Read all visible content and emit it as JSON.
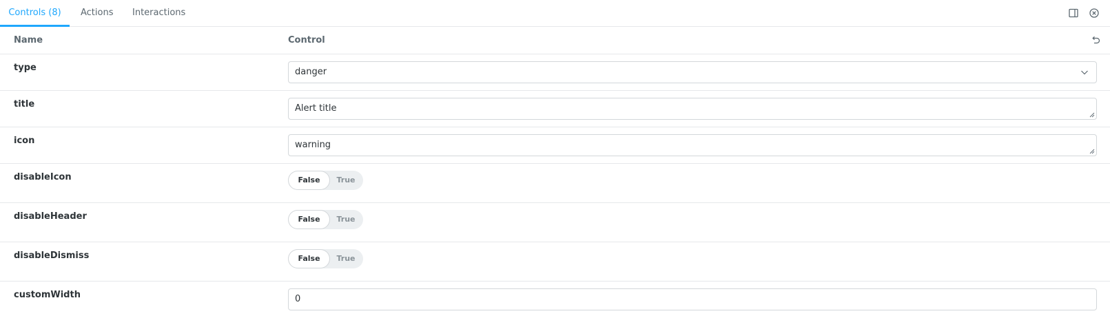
{
  "tabs": [
    {
      "label": "Controls (8)"
    },
    {
      "label": "Actions"
    },
    {
      "label": "Interactions"
    }
  ],
  "toolbar_icons": [
    "panel-toggle-icon",
    "close-circle-icon"
  ],
  "accent_color": "#1ea7fd",
  "table": {
    "header_name": "Name",
    "header_control": "Control",
    "reset_icon": "undo-icon"
  },
  "rows": {
    "type": {
      "name": "type",
      "value": "danger",
      "kind": "select"
    },
    "title": {
      "name": "title",
      "value": "Alert title",
      "kind": "textarea"
    },
    "icon": {
      "name": "icon",
      "value": "warning",
      "kind": "textarea"
    },
    "disableIcon": {
      "name": "disableIcon",
      "false_label": "False",
      "true_label": "True",
      "selected": "False"
    },
    "disableHeader": {
      "name": "disableHeader",
      "false_label": "False",
      "true_label": "True",
      "selected": "False"
    },
    "disableDismiss": {
      "name": "disableDismiss",
      "false_label": "False",
      "true_label": "True",
      "selected": "False"
    },
    "customWidth": {
      "name": "customWidth",
      "value": "0",
      "kind": "number"
    }
  }
}
